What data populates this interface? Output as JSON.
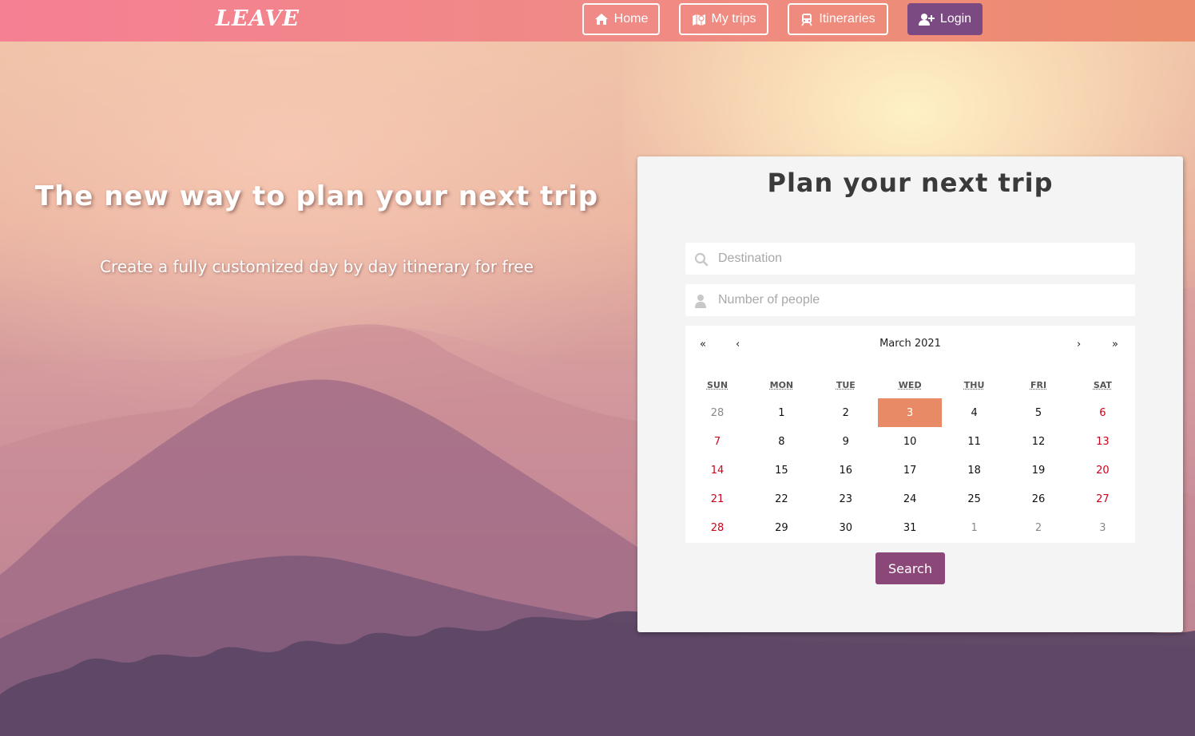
{
  "navbar": {
    "logo": "LEAVE",
    "home_label": "Home",
    "trips_label": "My trips",
    "itineraries_label": "Itineraries",
    "login_label": "Login"
  },
  "hero": {
    "title": "The new way to plan your next trip",
    "subtitle": "Create a fully customized day by day itinerary for free"
  },
  "planner": {
    "title": "Plan your next trip",
    "destination_placeholder": "Destination",
    "people_placeholder": "Number of people",
    "search_label": "Search"
  },
  "calendar": {
    "month": "March 2021",
    "prev_year": "«",
    "prev_month": "‹",
    "next_month": "›",
    "next_year": "»",
    "weekdays": [
      "SUN",
      "MON",
      "TUE",
      "WED",
      "THU",
      "FRI",
      "SAT"
    ],
    "weeks": [
      [
        {
          "d": "28",
          "t": "other"
        },
        {
          "d": "1",
          "t": ""
        },
        {
          "d": "2",
          "t": ""
        },
        {
          "d": "3",
          "t": "selected"
        },
        {
          "d": "4",
          "t": ""
        },
        {
          "d": "5",
          "t": ""
        },
        {
          "d": "6",
          "t": "weekend"
        }
      ],
      [
        {
          "d": "7",
          "t": "weekend"
        },
        {
          "d": "8",
          "t": ""
        },
        {
          "d": "9",
          "t": ""
        },
        {
          "d": "10",
          "t": ""
        },
        {
          "d": "11",
          "t": ""
        },
        {
          "d": "12",
          "t": ""
        },
        {
          "d": "13",
          "t": "weekend"
        }
      ],
      [
        {
          "d": "14",
          "t": "weekend"
        },
        {
          "d": "15",
          "t": ""
        },
        {
          "d": "16",
          "t": ""
        },
        {
          "d": "17",
          "t": ""
        },
        {
          "d": "18",
          "t": ""
        },
        {
          "d": "19",
          "t": ""
        },
        {
          "d": "20",
          "t": "weekend"
        }
      ],
      [
        {
          "d": "21",
          "t": "weekend"
        },
        {
          "d": "22",
          "t": ""
        },
        {
          "d": "23",
          "t": ""
        },
        {
          "d": "24",
          "t": ""
        },
        {
          "d": "25",
          "t": ""
        },
        {
          "d": "26",
          "t": ""
        },
        {
          "d": "27",
          "t": "weekend"
        }
      ],
      [
        {
          "d": "28",
          "t": "weekend"
        },
        {
          "d": "29",
          "t": ""
        },
        {
          "d": "30",
          "t": ""
        },
        {
          "d": "31",
          "t": ""
        },
        {
          "d": "1",
          "t": "other"
        },
        {
          "d": "2",
          "t": "other"
        },
        {
          "d": "3",
          "t": "other"
        }
      ]
    ]
  },
  "colors": {
    "navbar_start": "#f57f93",
    "navbar_end": "#ec8d6e",
    "login_bg": "#7c4a83",
    "selected_day": "#e98a67",
    "weekend_text": "#d0021b",
    "search_bg": "#8a4778"
  },
  "icons": {
    "home": "home-icon",
    "trips": "map-icon",
    "itineraries": "train-icon",
    "login": "user-plus-icon",
    "destination": "search-icon",
    "people": "user-icon"
  }
}
